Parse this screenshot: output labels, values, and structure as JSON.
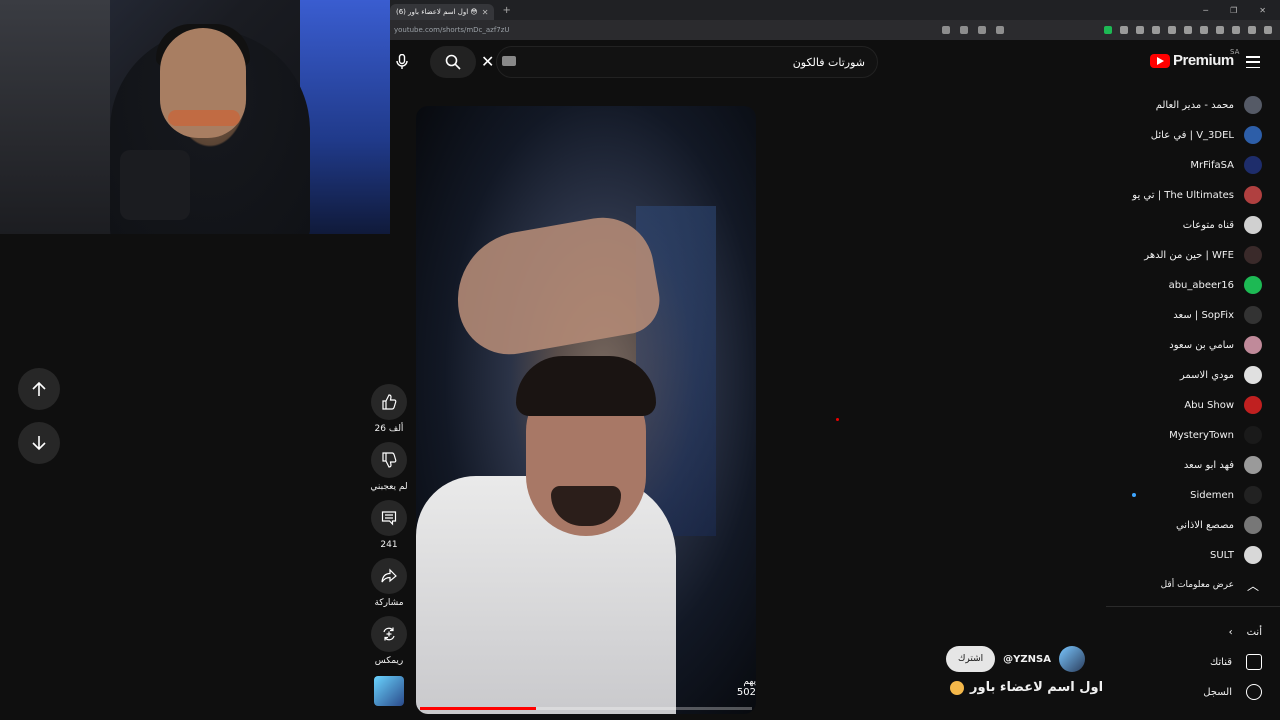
{
  "browser": {
    "tab_title": "(6) اول اسم لاعضاء باور 😳",
    "url": "youtube.com/shorts/mDc_azf7zU"
  },
  "header": {
    "search_query": "شورتات فالكون",
    "logo_text": "Premium",
    "region": "SA"
  },
  "sidebar": {
    "subscriptions": [
      {
        "name": "محمد - مدير العالم",
        "avatar_color": "#555a66"
      },
      {
        "name": "في عائل | V_3DEL",
        "avatar_color": "#2d5ea8"
      },
      {
        "name": "MrFifaSA",
        "avatar_color": "#1e2d6b"
      },
      {
        "name": "تي يو | The Ultimates",
        "avatar_color": "#b04040"
      },
      {
        "name": "قناه متوعات",
        "avatar_color": "#d0d0d0"
      },
      {
        "name": "حين من الدهر | WFE",
        "avatar_color": "#3a2a2a"
      },
      {
        "name": "abu_abeer16",
        "avatar_color": "#1db954"
      },
      {
        "name": "سعد | SopFix",
        "avatar_color": "#333"
      },
      {
        "name": "سامي بن سعود",
        "avatar_color": "#c08a9a"
      },
      {
        "name": "مودي الاسمر",
        "avatar_color": "#e0e0e0"
      },
      {
        "name": "Abu Show",
        "avatar_color": "#c02020"
      },
      {
        "name": "MysteryTown",
        "avatar_color": "#1a1a1a"
      },
      {
        "name": "فهد ابو سعد",
        "avatar_color": "#9a9a9a"
      },
      {
        "name": "Sidemen",
        "avatar_color": "#222",
        "new_content": true
      },
      {
        "name": "مصصع الاذاني",
        "avatar_color": "#777"
      },
      {
        "name": "SULT",
        "avatar_color": "#d8d8d8"
      }
    ],
    "show_less": "عرض معلومات أقل",
    "you_section": "أنت",
    "you_items": [
      {
        "label": "قناتك",
        "icon": "channel-icon"
      },
      {
        "label": "السجل",
        "icon": "history-icon"
      }
    ]
  },
  "actions": {
    "like_count": "26 ألف",
    "dislike_label": "لم يعجبني",
    "comment_count": "241",
    "share_label": "مشاركة",
    "remix_label": "ريمكس"
  },
  "video": {
    "views_prefix": "يهم",
    "views_count": "502",
    "progress": 0.35,
    "channel_handle": "@YZNSA",
    "subscribe_label": "اشترك",
    "title": "اول اسم لاعضاء باور"
  }
}
